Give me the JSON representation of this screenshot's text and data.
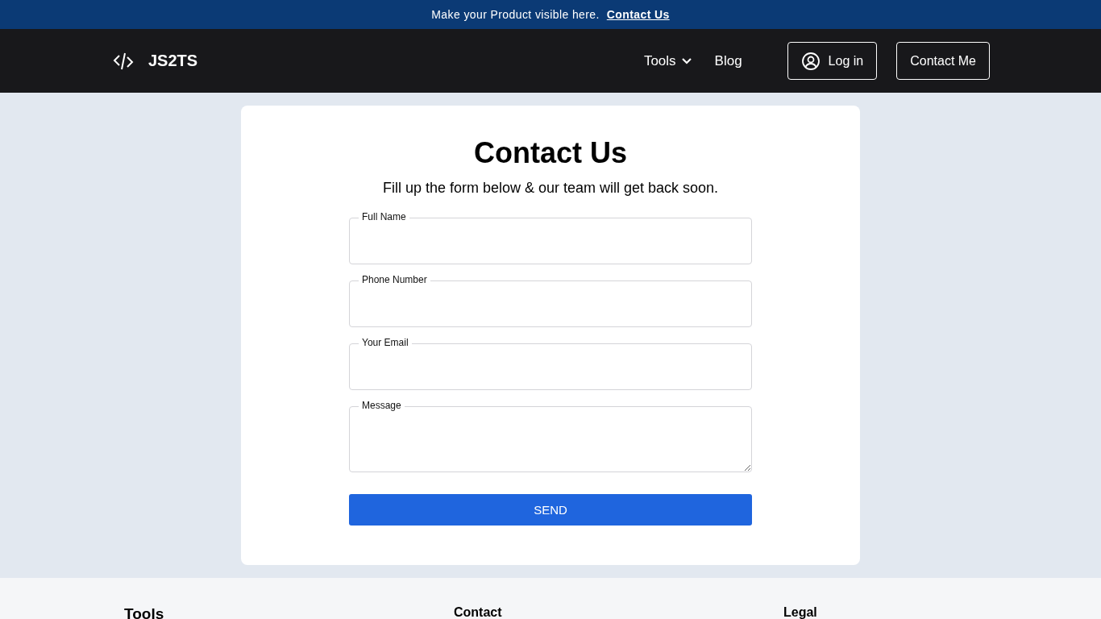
{
  "banner": {
    "text": "Make your Product visible here.",
    "link": "Contact Us"
  },
  "nav": {
    "brand": "JS2TS",
    "items": [
      {
        "label": "Tools",
        "kind": "dropdown"
      },
      {
        "label": "Blog",
        "kind": "link"
      }
    ],
    "login": "Log in",
    "contact": "Contact Me"
  },
  "form": {
    "title": "Contact Us",
    "subtitle": "Fill up the form below & our team will get back soon.",
    "fields": [
      {
        "label": "Full Name",
        "kind": "input"
      },
      {
        "label": "Phone Number",
        "kind": "input"
      },
      {
        "label": "Your Email",
        "kind": "input"
      },
      {
        "label": "Message",
        "kind": "textarea"
      }
    ],
    "submit": "SEND"
  },
  "footer": {
    "columns": [
      "Tools",
      "Contact",
      "Legal"
    ]
  }
}
